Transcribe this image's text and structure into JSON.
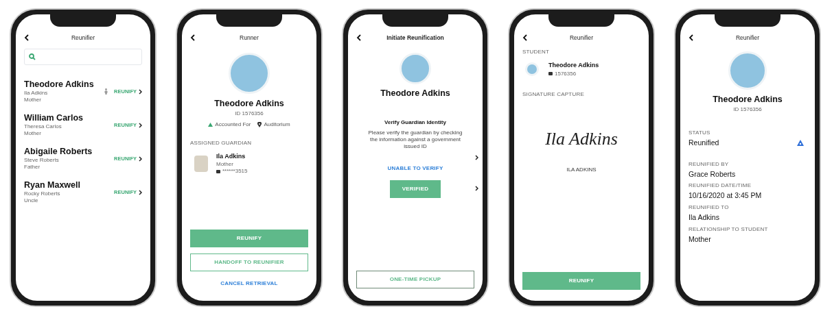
{
  "phones": [
    {
      "kind": "list",
      "title": "Reunifier",
      "students": [
        {
          "name": "Theodore Adkins",
          "guardian": "Ila Adkins",
          "relation": "Mother",
          "action": "REUNIFY",
          "flagged": true
        },
        {
          "name": "William Carlos",
          "guardian": "Theresa Carlos",
          "relation": "Mother",
          "action": "REUNIFY",
          "flagged": false
        },
        {
          "name": "Abigaile Roberts",
          "guardian": "Steve Roberts",
          "relation": "Father",
          "action": "REUNIFY",
          "flagged": false
        },
        {
          "name": "Ryan Maxwell",
          "guardian": "Rocky Roberts",
          "relation": "Uncle",
          "action": "REUNIFY",
          "flagged": false
        }
      ]
    },
    {
      "kind": "profile",
      "title": "Runner",
      "student": {
        "name": "Theodore Adkins",
        "id": "ID 1576356"
      },
      "status": "Accounted For",
      "location": "Auditorium",
      "section": "ASSIGNED GUARDIAN",
      "guardian": {
        "name": "Ila Adkins",
        "relation": "Mother",
        "phone": "******3515"
      },
      "buttons": [
        {
          "label": "REUNIFY",
          "kind": "filled"
        },
        {
          "label": "HANDOFF TO REUNIFIER",
          "kind": "outline"
        },
        {
          "label": "CANCEL RETRIEVAL",
          "kind": "link"
        }
      ]
    },
    {
      "kind": "dialog",
      "title": "Initiate Reunification",
      "student": {
        "name": "Theodore Adkins"
      },
      "dialog": {
        "title": "Verify Guardian Identity",
        "message": "Please verify the guardian by checking the information against a government issued ID",
        "buttons": [
          {
            "label": "UNABLE TO VERIFY",
            "kind": "link"
          },
          {
            "label": "VERIFIED",
            "kind": "filled"
          }
        ]
      },
      "buttons": [
        {
          "label": "ONE-TIME PICKUP",
          "kind": "outline"
        }
      ]
    },
    {
      "kind": "signature",
      "title": "Reunifier",
      "student_label": "STUDENT",
      "student": {
        "name": "Theodore Adkins",
        "id": "1576356"
      },
      "signature_label": "SIGNATURE CAPTURE",
      "signature": "Ila Adkins",
      "signer": "ILA ADKINS",
      "buttons": [
        {
          "label": "REUNIFY",
          "kind": "filled"
        }
      ]
    },
    {
      "kind": "summary",
      "title": "Reunifier",
      "student": {
        "name": "Theodore Adkins",
        "id": "ID 1576356"
      },
      "fields": [
        {
          "label": "STATUS",
          "value": "Reunified",
          "flagged": true
        },
        {
          "label": "REUNIFIED BY",
          "value": "Grace Roberts",
          "flagged": false
        },
        {
          "label": "REUNIFIED DATE/TIME",
          "value": "10/16/2020 at 3:45 PM",
          "flagged": false
        },
        {
          "label": "REUNIFIED TO",
          "value": "Ila Adkins",
          "flagged": false
        },
        {
          "label": "RELATIONSHIP TO STUDENT",
          "value": "Mother",
          "flagged": false
        }
      ]
    }
  ]
}
